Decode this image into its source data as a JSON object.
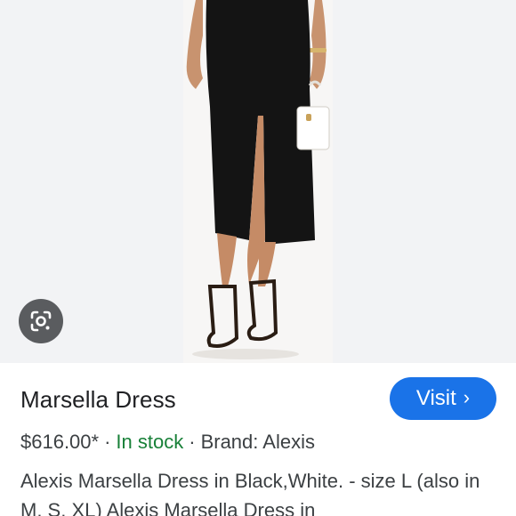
{
  "product": {
    "title": "Marsella Dress",
    "price": "$616.00*",
    "availability": "In stock",
    "brand": "Brand: Alexis",
    "description": "Alexis Marsella Dress in Black,White. - size L (also in M, S, XL) Alexis Marsella Dress in"
  },
  "actions": {
    "visit_label": "Visit",
    "visit_chevron": "›"
  },
  "icons": {
    "lens": "google-lens-icon"
  },
  "colors": {
    "accent": "#1a73e8",
    "in_stock": "#188038",
    "text": "#202124"
  }
}
